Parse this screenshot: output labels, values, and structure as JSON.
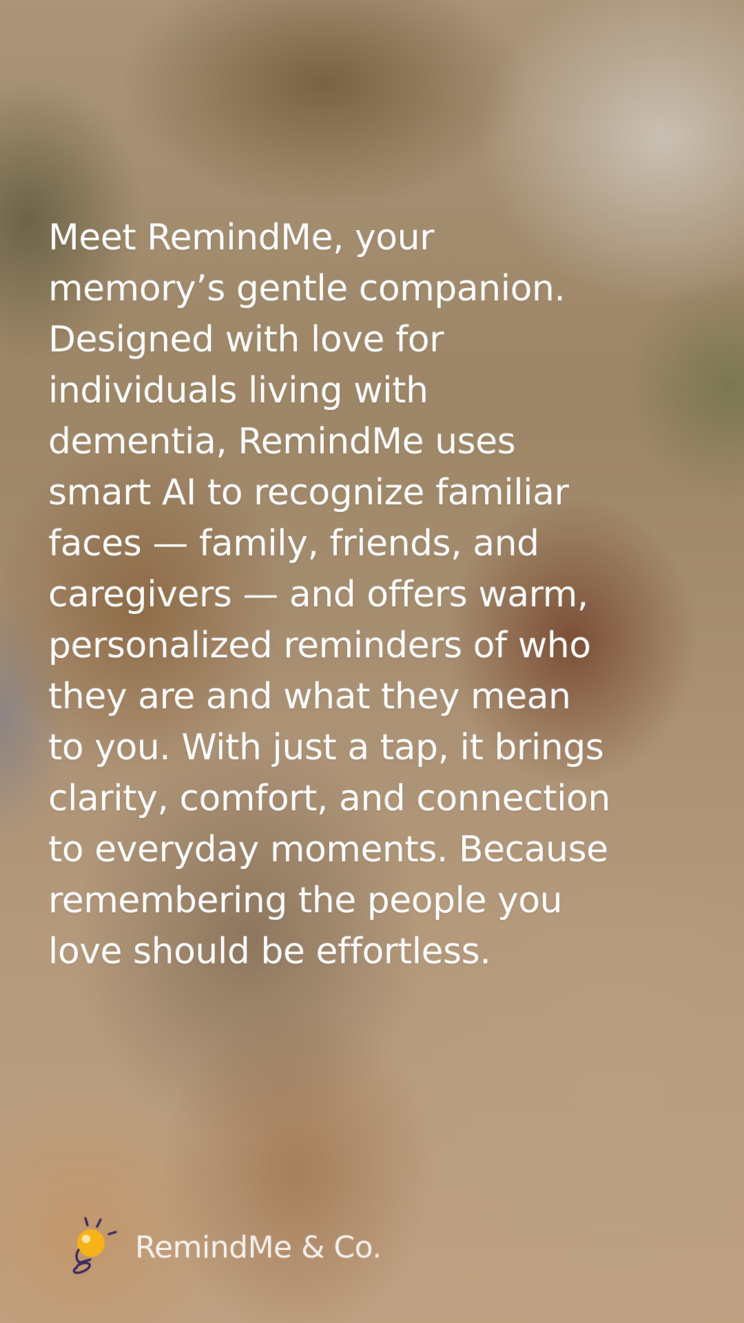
{
  "story": {
    "text": "Meet RemindMe, your memory’s gentle companion. Designed with love for individuals living with dementia, RemindMe uses smart AI to recognize familiar faces — family, friends, and caregivers — and offers warm, personalized reminders of who they are and what they mean to you. With just a tap, it brings clarity, comfort, and connection to everyday moments. Because remembering the people you love should be effortless."
  },
  "brand": {
    "name": "RemindMe & Co.",
    "icon": "lightbulb-icon",
    "icon_colors": {
      "bulb": "#f7b21a",
      "outline": "#3b2a5e"
    }
  }
}
